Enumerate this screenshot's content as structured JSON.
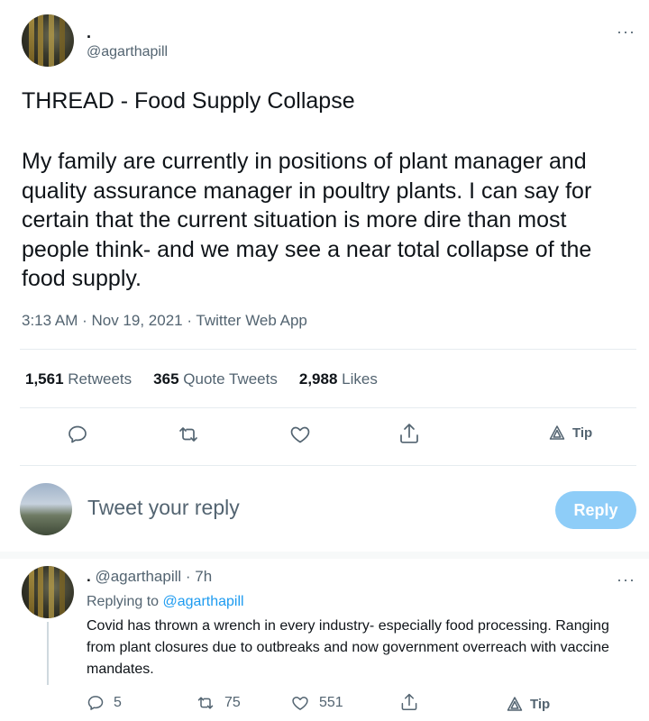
{
  "tweet": {
    "display_name": ".",
    "handle": "@agarthapill",
    "title": "THREAD - Food Supply Collapse",
    "body": "My family are currently in positions of plant manager and quality assurance manager in poultry plants. I can say for certain that the current situation is more dire than most people think- and we may see a near total collapse of the food supply.",
    "meta": "3:13 AM · Nov 19, 2021 · Twitter Web App",
    "more_icon": "···"
  },
  "stats": {
    "retweets_count": "1,561",
    "retweets_label": "Retweets",
    "quotes_count": "365",
    "quotes_label": "Quote Tweets",
    "likes_count": "2,988",
    "likes_label": "Likes"
  },
  "actions": {
    "tip_label": "Tip"
  },
  "composer": {
    "placeholder": "Tweet your reply",
    "reply_button": "Reply"
  },
  "reply": {
    "display_name": ".",
    "handle_time": "@agarthapill · 7h",
    "replying_prefix": "Replying to",
    "replying_handle": "@agarthapill",
    "text": "Covid has thrown a wrench in every industry- especially food processing. Ranging from plant closures due to outbreaks and now government overreach with vaccine mandates.",
    "reply_count": "5",
    "retweet_count": "75",
    "like_count": "551",
    "tip_label": "Tip",
    "more_icon": "···"
  },
  "colors": {
    "accent": "#1d9bf0",
    "reply_button_disabled": "#8ecdf8",
    "secondary_text": "#536471"
  },
  "icons": [
    "reply-icon",
    "retweet-icon",
    "like-icon",
    "share-icon",
    "tip-icon",
    "more-icon"
  ]
}
